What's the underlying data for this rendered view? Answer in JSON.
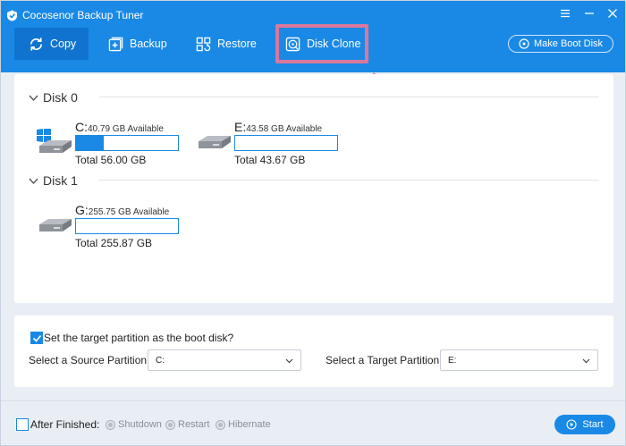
{
  "window": {
    "title": "Cocosenor Backup Tuner"
  },
  "toolbar": {
    "copy": "Copy",
    "backup": "Backup",
    "restore": "Restore",
    "disk_clone": "Disk Clone",
    "make_boot_disk": "Make Boot Disk"
  },
  "disks": [
    {
      "name": "Disk 0",
      "partitions": [
        {
          "letter": "C:",
          "available": "40.79 GB Available",
          "total": "Total 56.00 GB",
          "used_fraction": 0.27,
          "system": true
        },
        {
          "letter": "E:",
          "available": "43.58 GB Available",
          "total": "Total 43.67 GB",
          "used_fraction": 0.0,
          "system": false
        }
      ]
    },
    {
      "name": "Disk 1",
      "partitions": [
        {
          "letter": "G:",
          "available": "255.75 GB Available",
          "total": "Total 255.87 GB",
          "used_fraction": 0.0,
          "system": false
        }
      ]
    }
  ],
  "settings": {
    "boot_checkbox_label": "Set the target partition as the boot disk?",
    "boot_checked": true,
    "source_label": "Select a Source Partition:",
    "source_value": "C:",
    "target_label": "Select a Target Partition:",
    "target_value": "E:"
  },
  "footer": {
    "after_finished_label": "After Finished:",
    "options": [
      "Shutdown",
      "Restart",
      "Hibernate"
    ],
    "start_label": "Start"
  },
  "colors": {
    "accent": "#1a89e6",
    "highlight": "#d9789c"
  }
}
